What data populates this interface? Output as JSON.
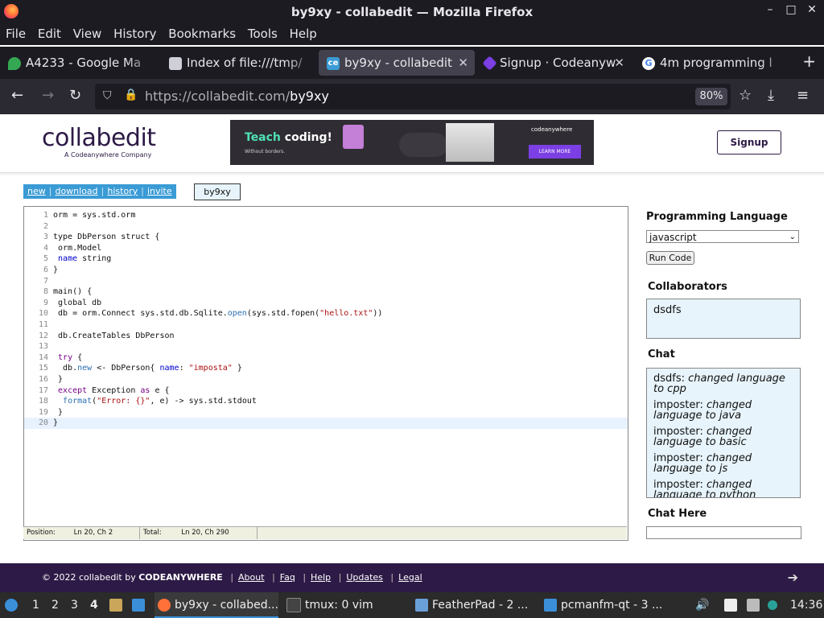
{
  "window": {
    "title": "by9xy - collabedit — Mozilla Firefox",
    "controls": [
      "–",
      "□",
      "✕"
    ]
  },
  "menubar": [
    "File",
    "Edit",
    "View",
    "History",
    "Bookmarks",
    "Tools",
    "Help"
  ],
  "tabs": [
    {
      "label": "A4233 - Google Ma",
      "icon_color": "#34a853"
    },
    {
      "label": "Index of file:///tmp/",
      "icon_color": "#cfcfd8"
    },
    {
      "label": "by9xy - collabedit",
      "icon_color": "#3a9bd5",
      "icon_text": "ce"
    },
    {
      "label": "Signup · Codeanyw",
      "icon_color": "#7b3fe4"
    },
    {
      "label": "4m programming l",
      "icon_color": "#ffffff",
      "icon_text": "G"
    }
  ],
  "newtab": "+",
  "nav": {
    "url_host": "https://collabedit.com/",
    "url_path": "by9xy",
    "zoom": "80%"
  },
  "header": {
    "logo_main": "collabedit",
    "logo_sub": "A Codeanywhere Company",
    "banner_headline_a": "Teach",
    "banner_headline_b": "coding!",
    "banner_tag": "Without borders.",
    "banner_brand": "codeanywhere",
    "banner_cta": "LEARN MORE",
    "signup": "Signup"
  },
  "toolbar": {
    "links": [
      "new",
      "download",
      "history",
      "invite"
    ],
    "docname": "by9xy"
  },
  "code_lines": [
    "orm = sys.std.orm",
    "",
    "type DbPerson struct {",
    " orm.Model",
    " name string",
    "}",
    "",
    "main() {",
    " global db",
    " db = orm.Connect sys.std.db.Sqlite.open(sys.std.fopen(\"hello.txt\"))",
    "",
    " db.CreateTables DbPerson",
    "",
    " try {",
    "  db.new <- DbPerson{ name: \"imposta\" }",
    " }",
    " except Exception as e {",
    "  format(\"Error: {}\", e) -> sys.std.stdout",
    " }",
    "}"
  ],
  "status": {
    "position_label": "Position:",
    "position_value": "Ln 20, Ch 2",
    "total_label": "Total:",
    "total_value": "Ln 20, Ch 290"
  },
  "sidebar": {
    "lang_heading": "Programming Language",
    "lang_selected": "javascript",
    "run_label": "Run Code",
    "collab_heading": "Collaborators",
    "collaborators": [
      "dsdfs"
    ],
    "chat_heading": "Chat",
    "chat": [
      {
        "user": "dsdfs:",
        "text": "changed language to cpp"
      },
      {
        "user": "imposter:",
        "text": "changed language to java"
      },
      {
        "user": "imposter:",
        "text": "changed language to basic"
      },
      {
        "user": "imposter:",
        "text": "changed language to js"
      },
      {
        "user": "imposter:",
        "text": "changed language to python"
      }
    ],
    "chat_here_heading": "Chat Here"
  },
  "footer": {
    "copy": "© 2022 collabedit by",
    "brand": "CODEANYWHERE",
    "links": [
      "About",
      "Faq",
      "Help",
      "Updates",
      "Legal"
    ]
  },
  "taskbar": {
    "workspaces": [
      "1",
      "2",
      "3",
      "4"
    ],
    "apps": [
      "by9xy - collabed...",
      "tmux: 0 vim",
      "FeatherPad - 2 ...",
      "pcmanfm-qt - 3 ..."
    ],
    "clock": "14:36"
  }
}
